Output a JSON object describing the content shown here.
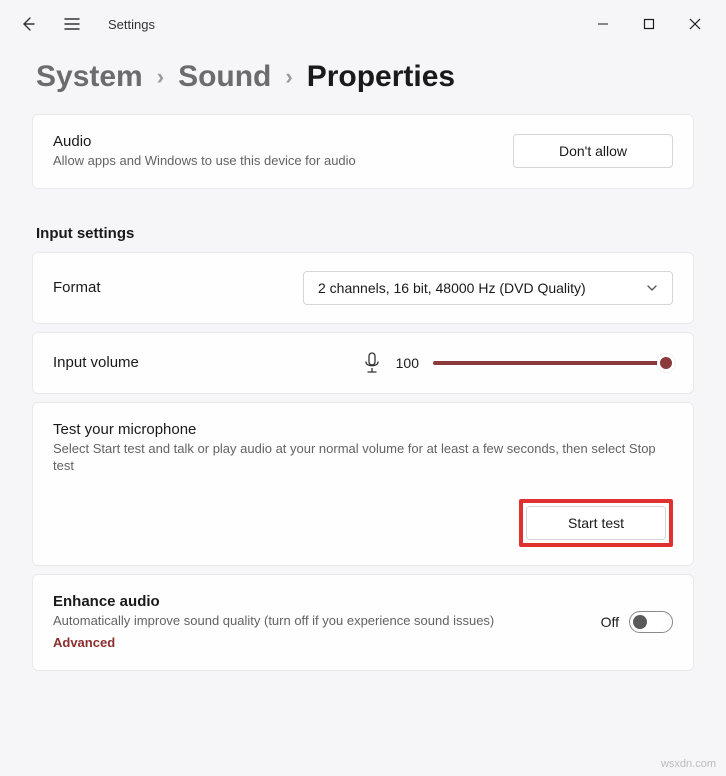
{
  "app": {
    "title": "Settings"
  },
  "breadcrumb": {
    "system": "System",
    "sound": "Sound",
    "properties": "Properties"
  },
  "audio_card": {
    "title": "Audio",
    "subtitle": "Allow apps and Windows to use this device for audio",
    "button": "Don't allow"
  },
  "section_heading": "Input settings",
  "format_card": {
    "label": "Format",
    "value": "2 channels, 16 bit, 48000 Hz (DVD Quality)"
  },
  "volume_card": {
    "label": "Input volume",
    "value": "100"
  },
  "test_card": {
    "title": "Test your microphone",
    "subtitle": "Select Start test and talk or play audio at your normal volume for at least a few seconds, then select Stop test",
    "button": "Start test"
  },
  "enhance_card": {
    "title": "Enhance audio",
    "subtitle": "Automatically improve sound quality (turn off if you experience sound issues)",
    "advanced": "Advanced",
    "toggle_state": "Off"
  },
  "watermark": "wsxdn.com"
}
